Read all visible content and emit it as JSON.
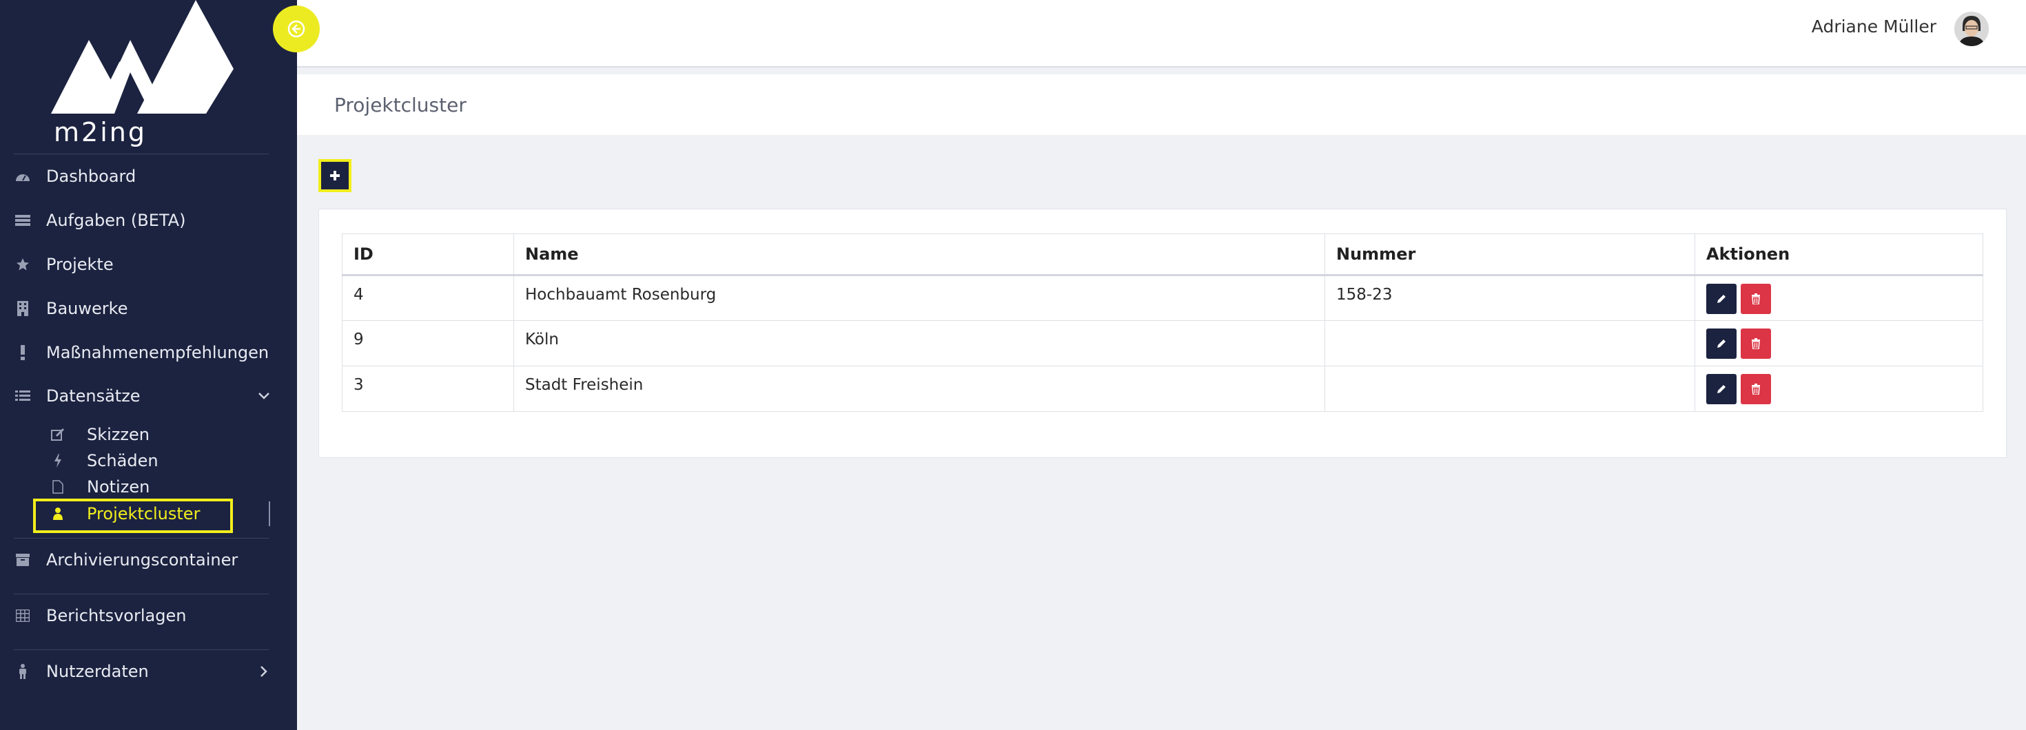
{
  "brand": {
    "name": "m2ing"
  },
  "user": {
    "name": "Adriane Müller"
  },
  "sidebar": {
    "items": [
      {
        "label": "Dashboard",
        "icon": "dashboard-icon"
      },
      {
        "label": "Aufgaben (BETA)",
        "icon": "tasks-icon"
      },
      {
        "label": "Projekte",
        "icon": "star-icon"
      },
      {
        "label": "Bauwerke",
        "icon": "building-icon"
      },
      {
        "label": "Maßnahmenempfehlungen",
        "icon": "exclamation-icon"
      },
      {
        "label": "Datensätze",
        "icon": "list-icon"
      },
      {
        "label": "Archivierungscontainer",
        "icon": "archive-icon"
      },
      {
        "label": "Berichtsvorlagen",
        "icon": "table-icon"
      },
      {
        "label": "Nutzerdaten",
        "icon": "user-icon"
      }
    ],
    "subitems": [
      {
        "label": "Skizzen",
        "icon": "edit-icon"
      },
      {
        "label": "Schäden",
        "icon": "bolt-icon"
      },
      {
        "label": "Notizen",
        "icon": "file-icon"
      },
      {
        "label": "Projektcluster",
        "icon": "person-icon"
      }
    ]
  },
  "page": {
    "title": "Projektcluster"
  },
  "table": {
    "headers": [
      "ID",
      "Name",
      "Nummer",
      "Aktionen"
    ],
    "rows": [
      {
        "id": "4",
        "name": "Hochbauamt Rosenburg",
        "nummer": "158-23"
      },
      {
        "id": "9",
        "name": "Köln",
        "nummer": ""
      },
      {
        "id": "3",
        "name": "Stadt Freishein",
        "nummer": ""
      }
    ]
  },
  "colors": {
    "sidebar": "#1c2340",
    "accent": "#f2ee1c",
    "danger": "#dc3545"
  }
}
